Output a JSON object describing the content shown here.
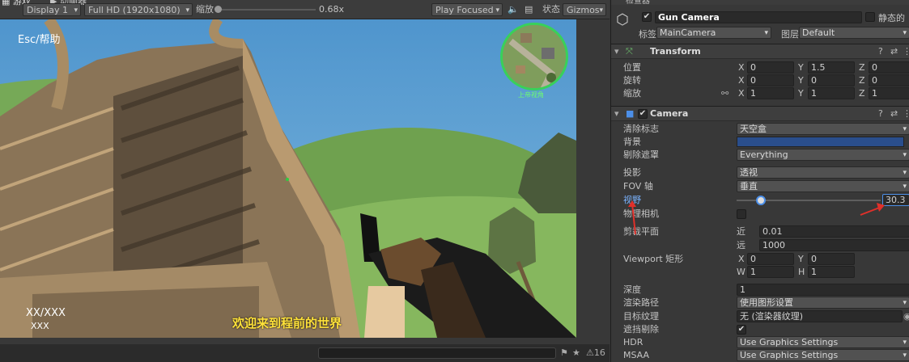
{
  "gamebar": {
    "tab_game": "游戏",
    "tab_anim": "动画器",
    "display": "Display 1",
    "resolution": "Full HD (1920x1080)",
    "scale_label": "缩放",
    "scale_value": "0.68x",
    "play_mode": "Play Focused",
    "stats": "状态",
    "gizmos": "Gizmos"
  },
  "game": {
    "help_text": "Esc/帮助",
    "minimap_label": "上帝视角",
    "ammo": "XX/XXX",
    "ammo_sub": "XXX",
    "welcome": "欢迎来到程前的世界"
  },
  "bottom": {
    "count": "16"
  },
  "inspector": {
    "tab": "检查器",
    "object_name": "Gun Camera",
    "static_label": "静态的",
    "tag_label": "标签",
    "tag_value": "MainCamera",
    "layer_label": "图层",
    "layer_value": "Default",
    "transform": {
      "title": "Transform",
      "rows": [
        {
          "label": "位置",
          "x": "0",
          "y": "1.5",
          "z": "0"
        },
        {
          "label": "旋转",
          "x": "0",
          "y": "0",
          "z": "0"
        },
        {
          "label": "缩放",
          "x": "1",
          "y": "1",
          "z": "1"
        }
      ]
    },
    "camera": {
      "title": "Camera",
      "clear_flags_label": "清除标志",
      "clear_flags": "天空盒",
      "background_label": "背景",
      "background_color": "#2a4e8c",
      "culling_label": "剔除遮罩",
      "culling": "Everything",
      "projection_label": "投影",
      "projection": "透视",
      "fov_axis_label": "FOV 轴",
      "fov_axis": "垂直",
      "fov_label": "视野",
      "fov_value": "30.3",
      "fov_fraction": 0.17,
      "physical_label": "物理相机",
      "clip_label": "剪裁平面",
      "near_label": "近",
      "near": "0.01",
      "far_label": "远",
      "far": "1000",
      "viewport_label": "Viewport 矩形",
      "vx": "0",
      "vy": "0",
      "vw": "1",
      "vh": "1",
      "depth_label": "深度",
      "depth": "1",
      "render_path_label": "渲染路径",
      "render_path": "使用图形设置",
      "target_tex_label": "目标纹理",
      "target_tex": "无 (渲染器纹理)",
      "occlusion_label": "遮挡剔除",
      "hdr_label": "HDR",
      "hdr": "Use Graphics Settings",
      "msaa_label": "MSAA",
      "msaa": "Use Graphics Settings"
    }
  },
  "colors": {
    "accent_blue": "#4c8fe8",
    "annotation_red": "#e0302a",
    "welcome_yellow": "#ffe23a",
    "minimap_ring": "#38d15a"
  }
}
